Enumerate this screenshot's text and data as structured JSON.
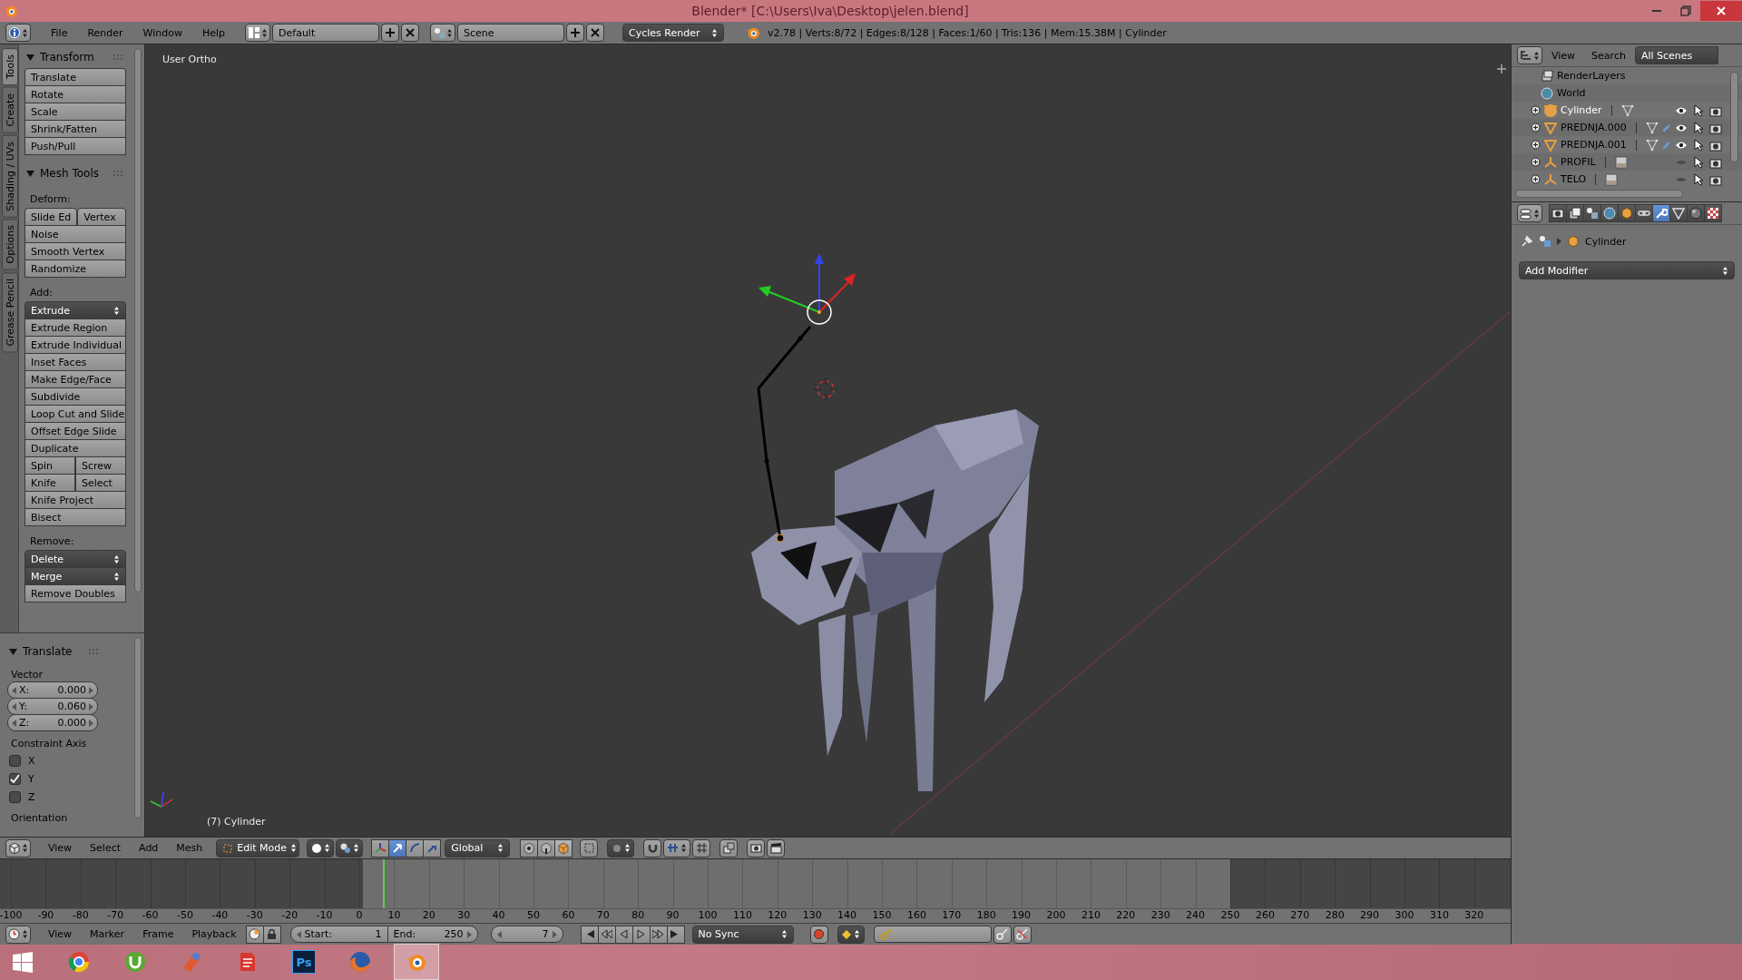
{
  "window": {
    "title": "Blender* [C:\\Users\\Iva\\Desktop\\jelen.blend]"
  },
  "info_header": {
    "menus": [
      "File",
      "Render",
      "Window",
      "Help"
    ],
    "layout": "Default",
    "scene": "Scene",
    "engine": "Cycles Render",
    "stats": "v2.78 | Verts:8/72 | Edges:8/128 | Faces:1/60 | Tris:136 | Mem:15.38M | Cylinder"
  },
  "tool_tabs": [
    {
      "label": "Tools",
      "selected": true
    },
    {
      "label": "Create",
      "selected": false
    },
    {
      "label": "Shading / UVs",
      "selected": false
    },
    {
      "label": "Options",
      "selected": false
    },
    {
      "label": "Grease Pencil",
      "selected": false
    }
  ],
  "tool_panels": [
    {
      "title": "Transform",
      "expanded": true,
      "rows": [
        {
          "kind": "button",
          "labels": [
            "Translate"
          ]
        },
        {
          "kind": "button",
          "labels": [
            "Rotate"
          ]
        },
        {
          "kind": "button",
          "labels": [
            "Scale"
          ]
        },
        {
          "kind": "button",
          "labels": [
            "Shrink/Fatten"
          ]
        },
        {
          "kind": "button",
          "labels": [
            "Push/Pull"
          ]
        }
      ]
    },
    {
      "title": "Mesh Tools",
      "expanded": true,
      "rows": [
        {
          "kind": "label",
          "labels": [
            "Deform:"
          ]
        },
        {
          "kind": "button",
          "labels": [
            "Slide Ed",
            "Vertex"
          ]
        },
        {
          "kind": "button",
          "labels": [
            "Noise"
          ]
        },
        {
          "kind": "button",
          "labels": [
            "Smooth Vertex"
          ]
        },
        {
          "kind": "button",
          "labels": [
            "Randomize"
          ]
        },
        {
          "kind": "label",
          "labels": [
            "Add:"
          ]
        },
        {
          "kind": "dropdown",
          "labels": [
            "Extrude"
          ]
        },
        {
          "kind": "button",
          "labels": [
            "Extrude Region"
          ]
        },
        {
          "kind": "button",
          "labels": [
            "Extrude Individual"
          ]
        },
        {
          "kind": "button",
          "labels": [
            "Inset Faces"
          ]
        },
        {
          "kind": "button",
          "labels": [
            "Make Edge/Face"
          ]
        },
        {
          "kind": "button",
          "labels": [
            "Subdivide"
          ]
        },
        {
          "kind": "button",
          "labels": [
            "Loop Cut and Slide"
          ]
        },
        {
          "kind": "button",
          "labels": [
            "Offset Edge Slide"
          ]
        },
        {
          "kind": "button",
          "labels": [
            "Duplicate"
          ]
        },
        {
          "kind": "button",
          "labels": [
            "Spin",
            "Screw"
          ]
        },
        {
          "kind": "button",
          "labels": [
            "Knife",
            "Select"
          ]
        },
        {
          "kind": "button",
          "labels": [
            "Knife Project"
          ]
        },
        {
          "kind": "button",
          "labels": [
            "Bisect"
          ]
        },
        {
          "kind": "label",
          "labels": [
            "Remove:"
          ]
        },
        {
          "kind": "dropdown",
          "labels": [
            "Delete"
          ]
        },
        {
          "kind": "dropdown",
          "labels": [
            "Merge"
          ]
        },
        {
          "kind": "button",
          "labels": [
            "Remove Doubles"
          ]
        }
      ]
    }
  ],
  "operator_panel": {
    "title": "Translate",
    "expanded": true,
    "vector_label": "Vector",
    "vector": [
      {
        "axis": "X:",
        "value": "0.000"
      },
      {
        "axis": "Y:",
        "value": "0.060"
      },
      {
        "axis": "Z:",
        "value": "0.000"
      }
    ],
    "constraint_label": "Constraint Axis",
    "constraints": [
      {
        "label": "X",
        "checked": false
      },
      {
        "label": "Y",
        "checked": true
      },
      {
        "label": "Z",
        "checked": false
      }
    ],
    "next_label": "Orientation"
  },
  "viewport": {
    "view_name": "User Ortho",
    "object_label": "(7) Cylinder"
  },
  "outliner": {
    "menus": [
      "View",
      "Search"
    ],
    "filter": "All Scenes",
    "scene_items": [
      {
        "name": "RenderLayers",
        "kind": "renderlayers"
      },
      {
        "name": "World",
        "kind": "world"
      }
    ],
    "objects": [
      {
        "name": "Cylinder",
        "kind": "mesh",
        "modifier": false,
        "selected": true,
        "visible": true
      },
      {
        "name": "PREDNJA.000",
        "kind": "mesh",
        "modifier": true,
        "selected": false,
        "visible": true
      },
      {
        "name": "PREDNJA.001",
        "kind": "mesh",
        "modifier": true,
        "selected": false,
        "visible": true
      },
      {
        "name": "PROFIL",
        "kind": "empty",
        "modifier": false,
        "selected": false,
        "visible": false
      },
      {
        "name": "TELO",
        "kind": "empty",
        "modifier": false,
        "selected": false,
        "visible": false
      }
    ]
  },
  "properties": {
    "tabs": [
      {
        "kind": "render",
        "selected": false
      },
      {
        "kind": "layers",
        "selected": false
      },
      {
        "kind": "scene",
        "selected": false
      },
      {
        "kind": "world",
        "selected": false
      },
      {
        "kind": "object",
        "selected": false
      },
      {
        "kind": "constraints",
        "selected": false
      },
      {
        "kind": "modifiers",
        "selected": true
      },
      {
        "kind": "data",
        "selected": false
      },
      {
        "kind": "material",
        "selected": false
      },
      {
        "kind": "texture",
        "selected": false
      }
    ],
    "context": "Cylinder",
    "add_modifier": "Add Modifier"
  },
  "view3d_header": {
    "menus": [
      "View",
      "Select",
      "Add",
      "Mesh"
    ],
    "mode": "Edit Mode",
    "orientation": "Global",
    "manipulators": [
      {
        "kind": "combined",
        "selected": false
      },
      {
        "kind": "translate",
        "selected": true
      },
      {
        "kind": "rotate",
        "selected": false
      },
      {
        "kind": "scale",
        "selected": false
      }
    ],
    "select_modes": [
      {
        "kind": "vertex",
        "selected": false
      },
      {
        "kind": "edge",
        "selected": false
      },
      {
        "kind": "face",
        "selected": true
      }
    ]
  },
  "timeline": {
    "ruler": [
      "-100",
      "-90",
      "-80",
      "-70",
      "-60",
      "-50",
      "-40",
      "-30",
      "-20",
      "-10",
      "0",
      "10",
      "20",
      "30",
      "40",
      "50",
      "60",
      "70",
      "80",
      "90",
      "100",
      "110",
      "120",
      "130",
      "140",
      "150",
      "160",
      "170",
      "180",
      "190",
      "200",
      "210",
      "220",
      "230",
      "240",
      "250",
      "260",
      "270",
      "280",
      "290",
      "300",
      "310",
      "320"
    ],
    "menus": [
      "View",
      "Marker",
      "Frame",
      "Playback"
    ],
    "start_label": "Start:",
    "start": "1",
    "end_label": "End:",
    "end": "250",
    "current_frame": "7",
    "sync": "No Sync"
  },
  "taskbar": {
    "apps": [
      {
        "kind": "start",
        "selected": false
      },
      {
        "kind": "chrome",
        "selected": false
      },
      {
        "kind": "torrent",
        "selected": false
      },
      {
        "kind": "tool",
        "selected": false
      },
      {
        "kind": "office",
        "selected": false
      },
      {
        "kind": "photo",
        "label": "Ps",
        "selected": false
      },
      {
        "kind": "fox",
        "selected": false
      },
      {
        "kind": "blender",
        "selected": true
      }
    ]
  }
}
